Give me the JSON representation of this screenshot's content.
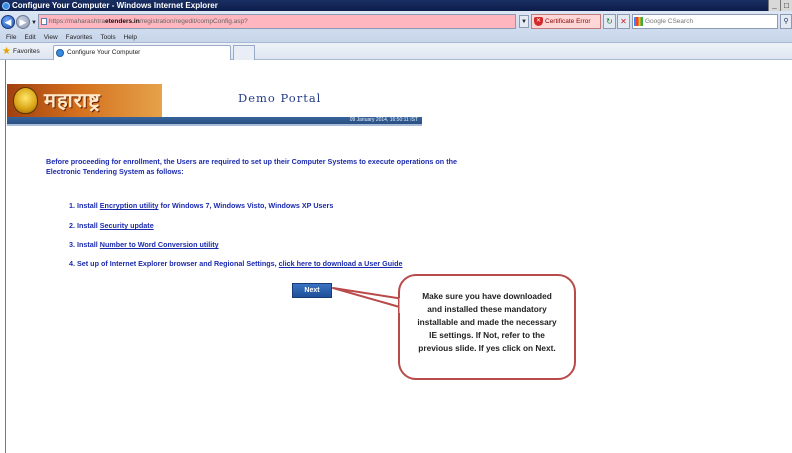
{
  "window": {
    "title": "Configure Your Computer - Windows Internet Explorer",
    "controls": [
      "_",
      "□"
    ]
  },
  "address": {
    "url_prefix": "https://maharashtra",
    "url_domain": "etenders.in",
    "url_suffix": "/registration/regedit/compConfig.asp?",
    "cert_error": "Certificate Error",
    "search_placeholder": "Google CSearch"
  },
  "menu": [
    "File",
    "Edit",
    "View",
    "Favorites",
    "Tools",
    "Help"
  ],
  "favorites": {
    "label": "Favorites",
    "tab_title": "Configure Your Computer"
  },
  "header": {
    "logo_text": "महाराष्ट्र",
    "portal_title": "Demo Portal",
    "date_time": "09 January 2014,  16:50:11  IST"
  },
  "content": {
    "intro": "Before proceeding for enrollment, the Users are required to set up their Computer Systems to execute operations on the Electronic Tendering System as follows:",
    "steps": [
      {
        "prefix": "1. Install ",
        "link": "Encryption utility",
        "suffix": " for Windows 7, Windows Visto, Windows XP Users"
      },
      {
        "prefix": "2. Install ",
        "link": "Security update",
        "suffix": ""
      },
      {
        "prefix": "3. Install ",
        "link": "Number to Word Conversion utility",
        "suffix": ""
      },
      {
        "prefix": "4. Set up of Internet Explorer browser and Regional Settings, ",
        "link": "click here to download a User Guide",
        "suffix": ""
      }
    ],
    "next_label": "Next"
  },
  "callout": {
    "text": "Make sure you have downloaded and installed these mandatory installable and made the necessary IE settings. If Not, refer to the previous slide. If yes click on Next.",
    "border_color": "#b84a4a"
  },
  "colors": {
    "link_blue": "#1b2bae",
    "banner_stripe": "#2a4f82",
    "next_button": "#1f4f99"
  }
}
